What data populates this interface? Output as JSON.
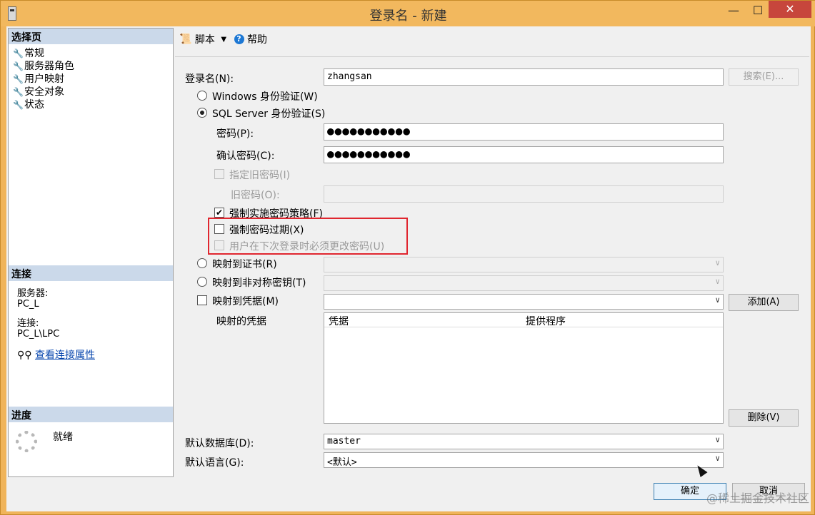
{
  "window": {
    "title": "登录名 - 新建",
    "min": "—",
    "max": "☐",
    "close": "✕"
  },
  "left": {
    "pages_header": "选择页",
    "pages": [
      "常规",
      "服务器角色",
      "用户映射",
      "安全对象",
      "状态"
    ],
    "connection_header": "连接",
    "server_label": "服务器:",
    "server_value": "PC_L",
    "connection_label": "连接:",
    "connection_value": "PC_L\\LPC",
    "view_properties": "查看连接属性",
    "progress_header": "进度",
    "progress_status": "就绪"
  },
  "toolbar": {
    "script": "脚本",
    "help": "帮助"
  },
  "form": {
    "login_name_label": "登录名(N):",
    "login_name_value": "zhangsan",
    "search_button": "搜索(E)...",
    "windows_auth": "Windows 身份验证(W)",
    "sql_auth": "SQL Server 身份验证(S)",
    "password_label": "密码(P):",
    "password_value": "●●●●●●●●●●●",
    "confirm_label": "确认密码(C):",
    "confirm_value": "●●●●●●●●●●●",
    "specify_old": "指定旧密码(I)",
    "old_password_label": "旧密码(O):",
    "enforce_policy": "强制实施密码策略(F)",
    "enforce_expiration": "强制密码过期(X)",
    "must_change": "用户在下次登录时必须更改密码(U)",
    "map_cert": "映射到证书(R)",
    "map_asym": "映射到非对称密钥(T)",
    "map_credential": "映射到凭据(M)",
    "add_button": "添加(A)",
    "mapped_credentials": "映射的凭据",
    "grid_col1": "凭据",
    "grid_col2": "提供程序",
    "remove_button": "删除(V)",
    "default_db_label": "默认数据库(D):",
    "default_db_value": "master",
    "default_lang_label": "默认语言(G):",
    "default_lang_value": "<默认>"
  },
  "footer": {
    "ok": "确定",
    "cancel": "取消",
    "watermark": "@稀土掘金技术社区"
  }
}
